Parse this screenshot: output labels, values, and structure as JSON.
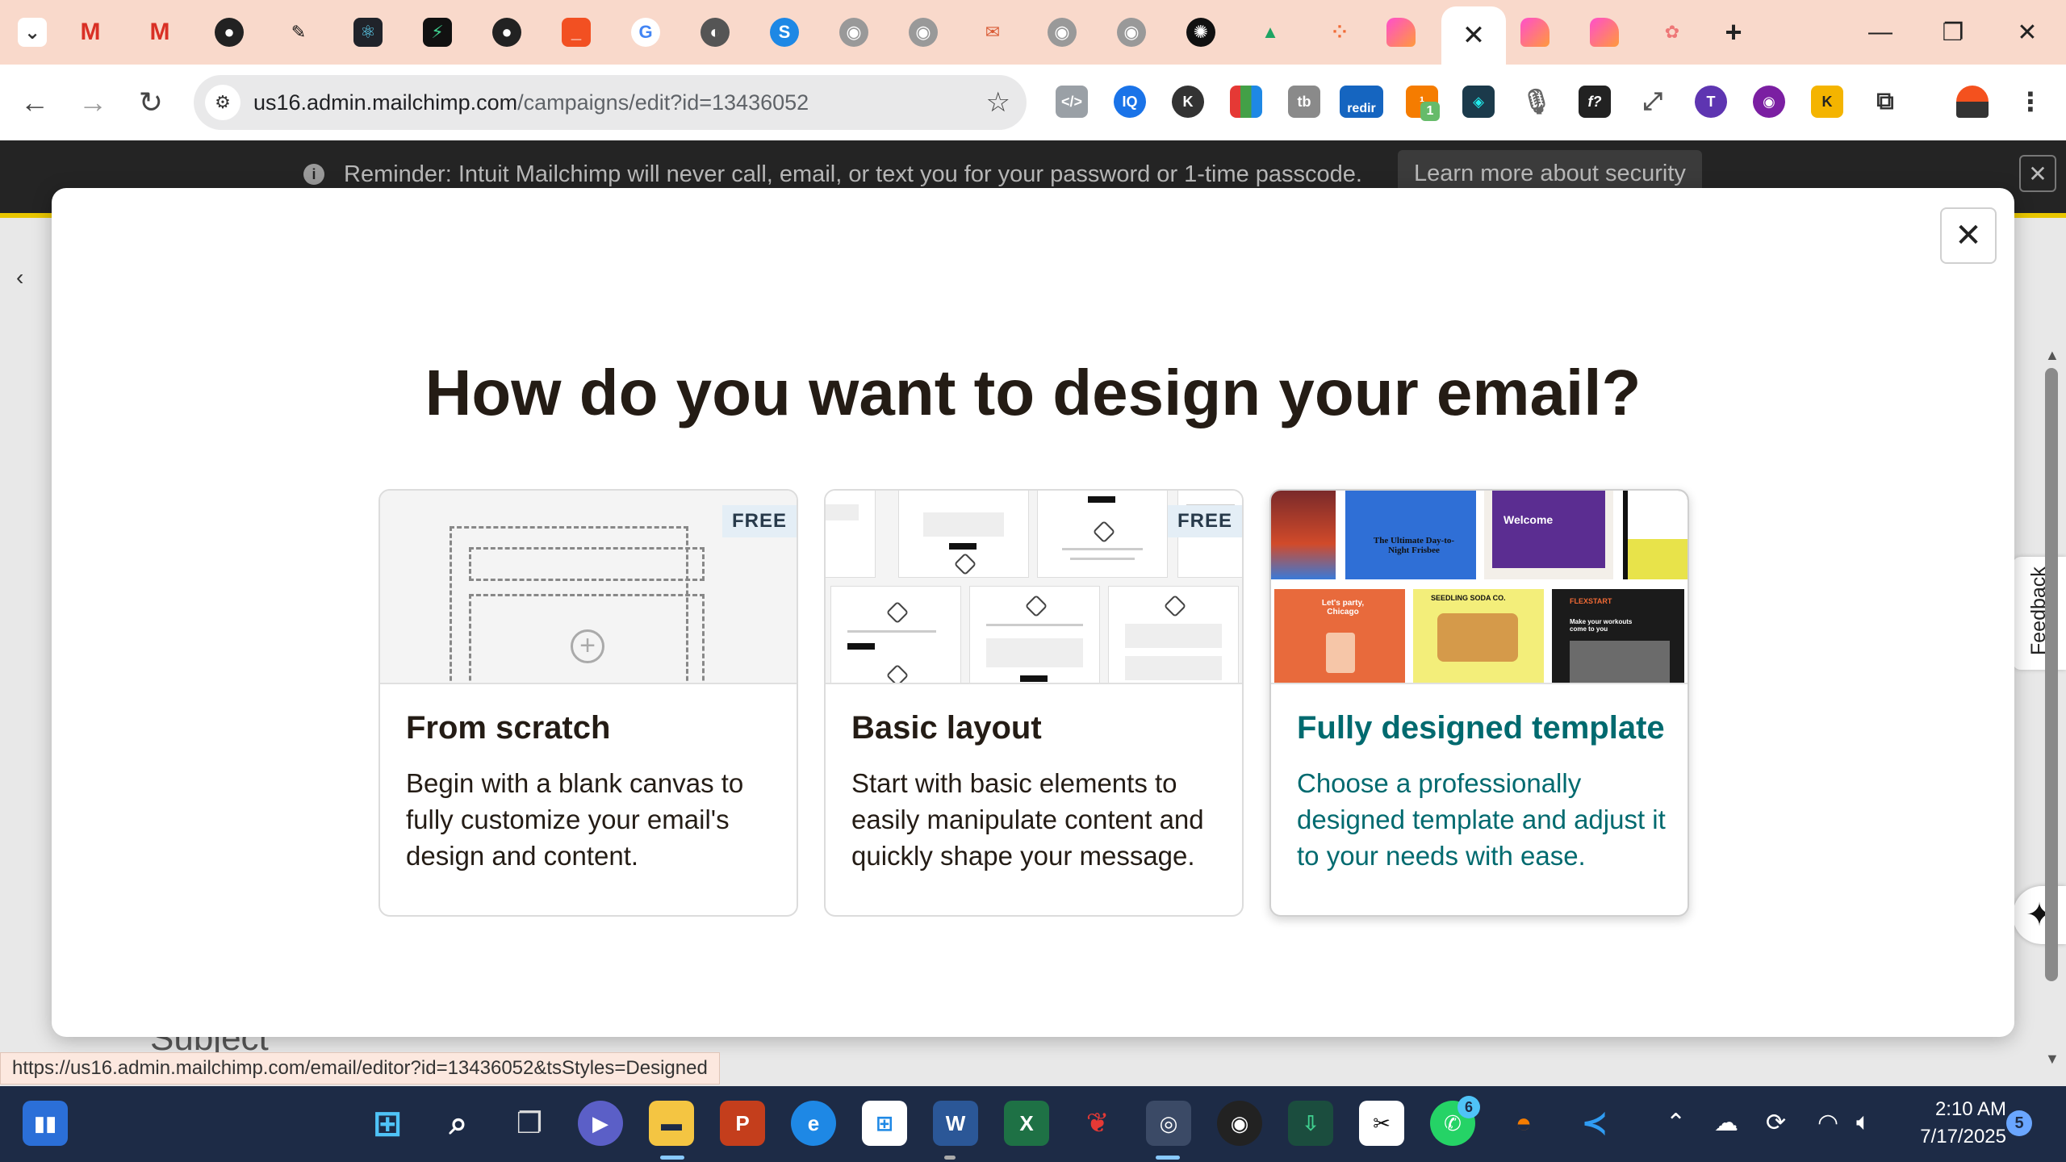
{
  "browser": {
    "active_tab_close": "✕",
    "new_tab": "+",
    "url_host": "us16.admin.mailchimp.com",
    "url_path": "/campaigns/edit?id=13436052",
    "status_url": "https://us16.admin.mailchimp.com/email/editor?id=13436052&tsStyles=Designed",
    "ext_badge_redir": "redir",
    "ext_badge_count": "1"
  },
  "banner": {
    "text": "Reminder: Intuit Mailchimp will never call, email, or text you for your password or 1-time passcode.",
    "link": "Learn more about security"
  },
  "page": {
    "subject_partial": "Subject",
    "feedback_label": "Feedback"
  },
  "modal": {
    "title": "How do you want to design your email?",
    "cards": [
      {
        "title": "From scratch",
        "description": "Begin with a blank canvas to fully customize your email's design and content.",
        "badge": "FREE"
      },
      {
        "title": "Basic layout",
        "description": "Start with basic elements to easily manipulate content and quickly shape your message.",
        "badge": "FREE"
      },
      {
        "title": "Fully designed template",
        "description": "Choose a professionally designed template and adjust it to your needs with ease.",
        "selected": true
      }
    ],
    "template_thumbs": [
      {
        "text": "The Ultimate Day-to-Night Frisbee",
        "color": "#2f6fd6"
      },
      {
        "text": "Welcome",
        "color": "#5b2d91"
      },
      {
        "text": "Let's party, Chicago",
        "color": "#e86a3c"
      },
      {
        "text": "SEEDLING SODA CO.",
        "color": "#f3ee7a"
      },
      {
        "text": "FLEXSTART",
        "color": "#1b1b1b"
      },
      {
        "text": "Make your workouts come to you",
        "color": "#1b1b1b"
      }
    ]
  },
  "taskbar": {
    "time": "2:10 AM",
    "date": "7/17/2025",
    "notifications": "5",
    "whatsapp_badge": "6"
  },
  "colors": {
    "accent_teal": "#006a6f",
    "tab_strip": "#f9d9cb",
    "banner_bg": "#242424",
    "banner_stripe": "#e8c600"
  }
}
